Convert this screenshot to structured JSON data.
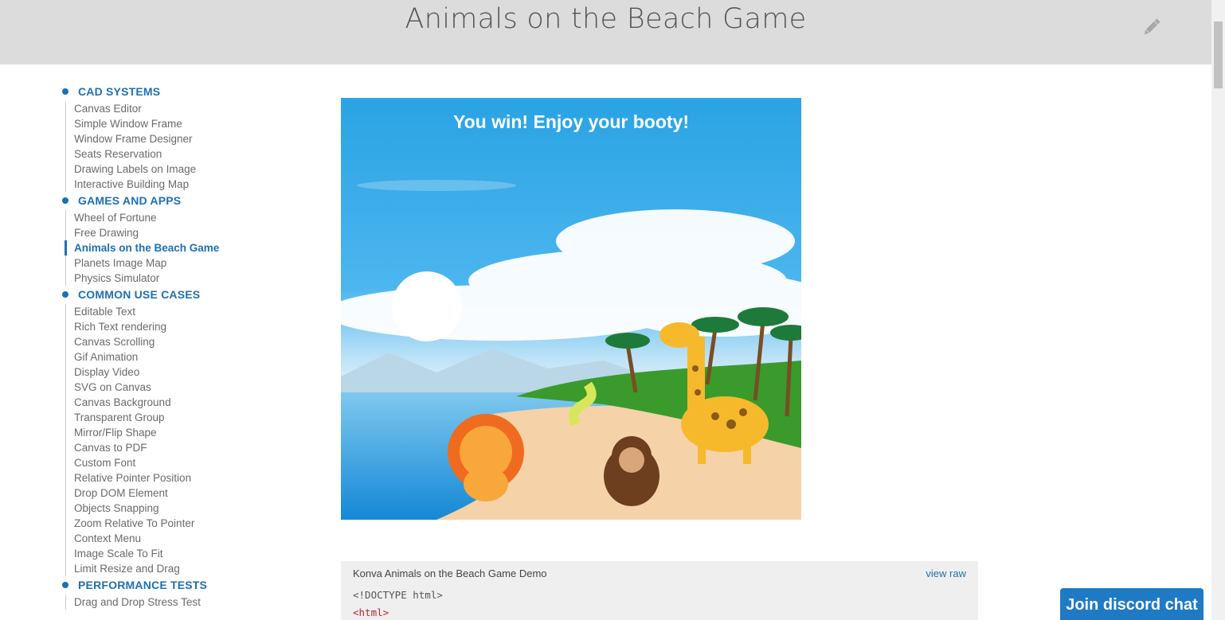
{
  "header": {
    "title": "Animals on the Beach Game"
  },
  "sidebar": {
    "sections": [
      {
        "title": "CAD SYSTEMS",
        "items": [
          "Canvas Editor",
          "Simple Window Frame",
          "Window Frame Designer",
          "Seats Reservation",
          "Drawing Labels on Image",
          "Interactive Building Map"
        ]
      },
      {
        "title": "GAMES AND APPS",
        "items": [
          "Wheel of Fortune",
          "Free Drawing",
          "Animals on the Beach Game",
          "Planets Image Map",
          "Physics Simulator"
        ]
      },
      {
        "title": "COMMON USE CASES",
        "items": [
          "Editable Text",
          "Rich Text rendering",
          "Canvas Scrolling",
          "Gif Animation",
          "Display Video",
          "SVG on Canvas",
          "Canvas Background",
          "Transparent Group",
          "Mirror/Flip Shape",
          "Canvas to PDF",
          "Custom Font",
          "Relative Pointer Position",
          "Drop DOM Element",
          "Objects Snapping",
          "Zoom Relative To Pointer",
          "Context Menu",
          "Image Scale To Fit",
          "Limit Resize and Drag"
        ]
      },
      {
        "title": "PERFORMANCE TESTS",
        "items": [
          "Drag and Drop Stress Test"
        ]
      }
    ],
    "active_item": "Animals on the Beach Game"
  },
  "game": {
    "message": "You win! Enjoy your booty!"
  },
  "code": {
    "title": "Konva Animals on the Beach Game Demo",
    "view_raw": "view raw",
    "line1": "<!DOCTYPE html>",
    "line2": "<html>"
  },
  "discord_button": "Join discord chat",
  "colors": {
    "accent": "#1f6fb2",
    "header_bg": "#dcdcdc",
    "sky": "#2ea6e4",
    "discord": "#1f7ac5"
  }
}
